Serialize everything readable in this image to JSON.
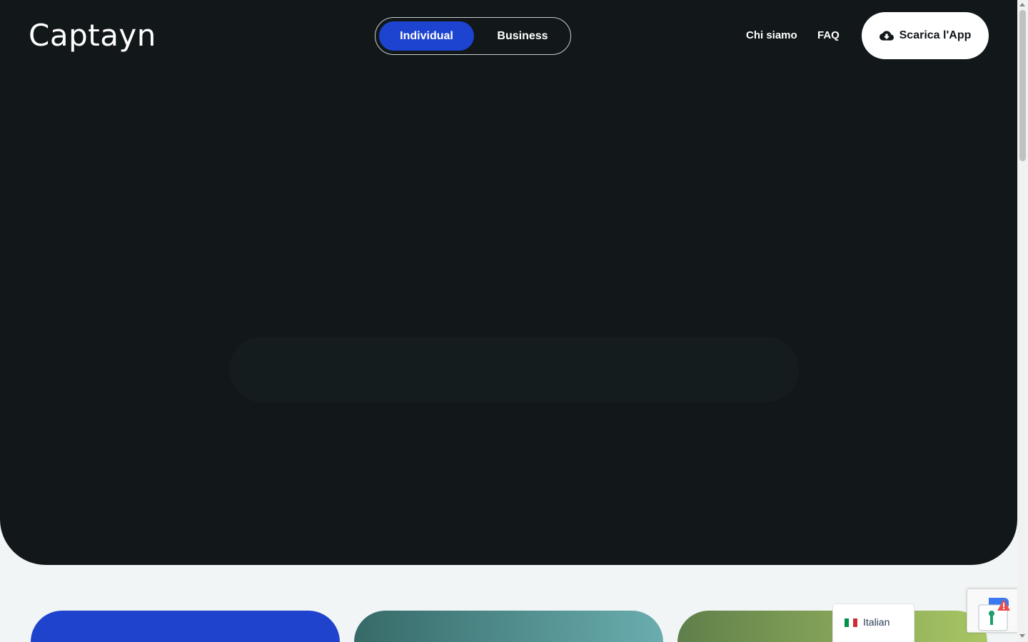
{
  "header": {
    "logo": "Captayn",
    "segment": {
      "options": [
        "Individual",
        "Business"
      ],
      "selected": "Individual"
    },
    "nav": {
      "about": "Chi siamo",
      "faq": "FAQ"
    },
    "cta_label": "Scarica l'App"
  },
  "language_selector": {
    "label": "Italian"
  },
  "colors": {
    "hero_bg": "#12171a",
    "accent_blue": "#1d44d1",
    "page_bg": "#f1f5f6"
  }
}
